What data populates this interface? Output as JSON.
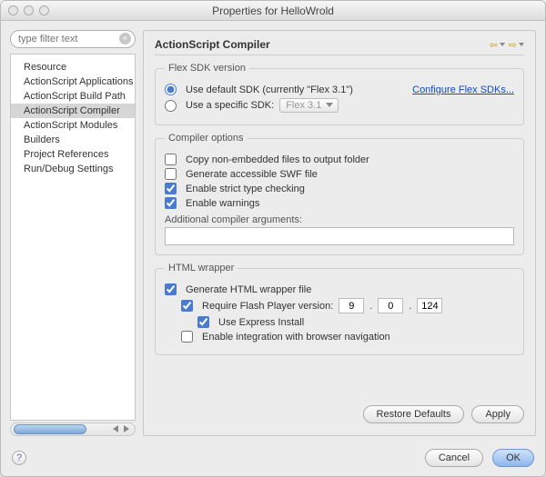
{
  "window": {
    "title": "Properties for HelloWrold"
  },
  "sidebar": {
    "filter_placeholder": "type filter text",
    "items": [
      {
        "label": "Resource"
      },
      {
        "label": "ActionScript Applications"
      },
      {
        "label": "ActionScript Build Path"
      },
      {
        "label": "ActionScript Compiler",
        "selected": true
      },
      {
        "label": "ActionScript Modules"
      },
      {
        "label": "Builders"
      },
      {
        "label": "Project References"
      },
      {
        "label": "Run/Debug Settings"
      }
    ]
  },
  "main": {
    "title": "ActionScript Compiler"
  },
  "flex_sdk": {
    "legend": "Flex SDK version",
    "use_default_label": "Use default SDK (currently \"Flex 3.1\")",
    "use_specific_label": "Use a specific SDK:",
    "specific_value": "Flex 3.1",
    "configure_link": "Configure Flex SDKs...",
    "selection": "default"
  },
  "compiler_options": {
    "legend": "Compiler options",
    "copy_label": "Copy non-embedded files to output folder",
    "copy_checked": false,
    "accessible_label": "Generate accessible SWF file",
    "accessible_checked": false,
    "strict_label": "Enable strict type checking",
    "strict_checked": true,
    "warnings_label": "Enable warnings",
    "warnings_checked": true,
    "args_label": "Additional compiler arguments:",
    "args_value": ""
  },
  "html_wrapper": {
    "legend": "HTML wrapper",
    "generate_label": "Generate HTML wrapper file",
    "generate_checked": true,
    "require_label": "Require Flash Player version:",
    "require_checked": true,
    "ver_major": "9",
    "ver_minor": "0",
    "ver_patch": "124",
    "express_label": "Use Express Install",
    "express_checked": true,
    "navigation_label": "Enable integration with browser navigation",
    "navigation_checked": false
  },
  "buttons": {
    "restore": "Restore Defaults",
    "apply": "Apply",
    "cancel": "Cancel",
    "ok": "OK",
    "help": "?"
  }
}
